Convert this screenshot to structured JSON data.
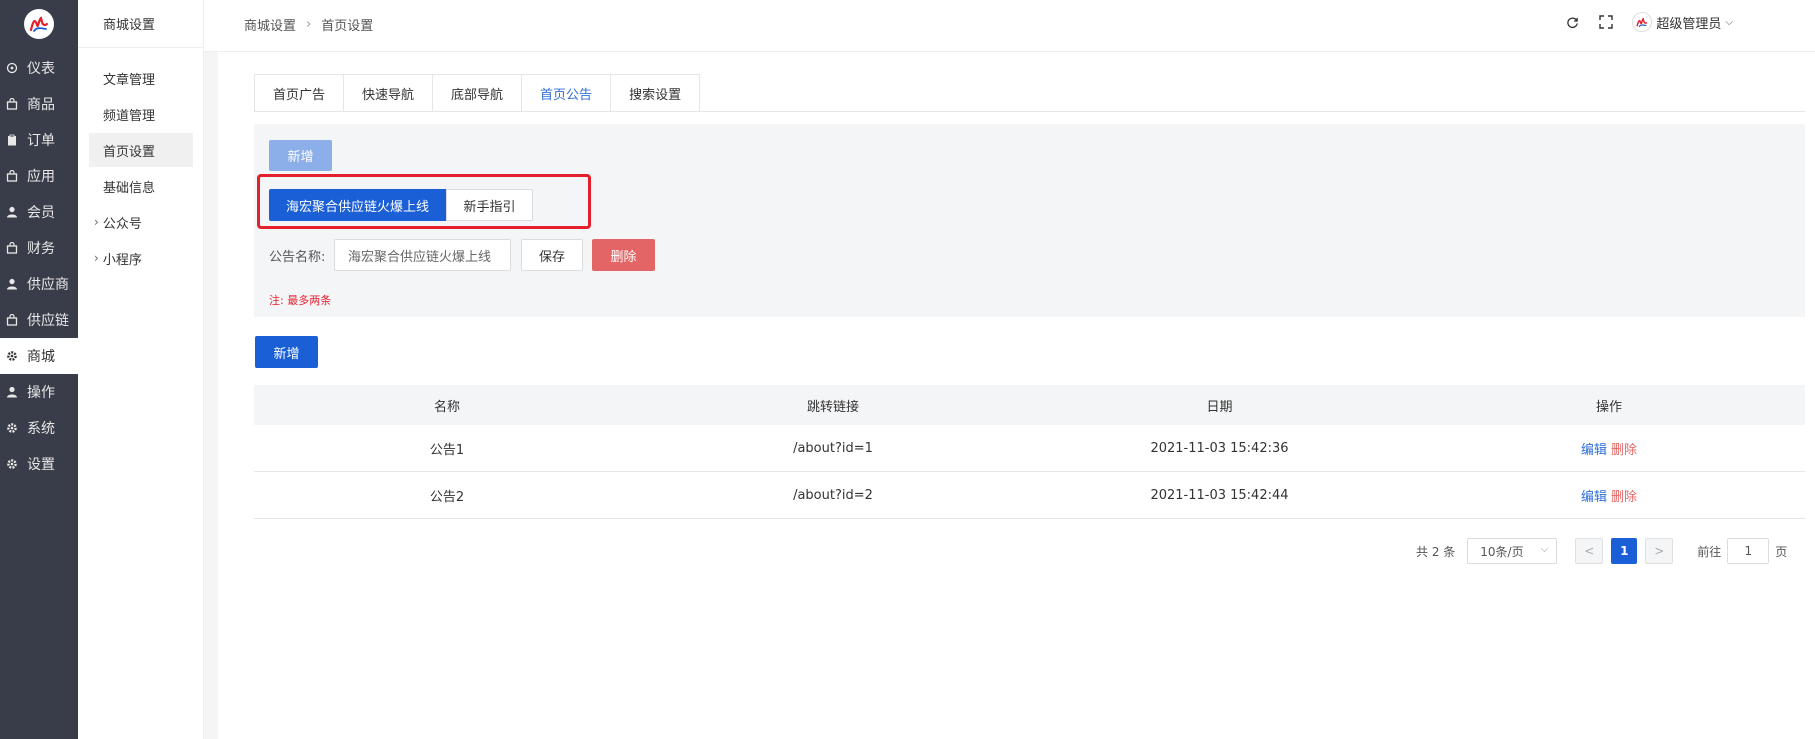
{
  "sidebar": {
    "items": [
      {
        "label": "仪表",
        "icon": "dashboard-icon"
      },
      {
        "label": "商品",
        "icon": "bag-icon"
      },
      {
        "label": "订单",
        "icon": "clipboard-icon"
      },
      {
        "label": "应用",
        "icon": "bag-icon"
      },
      {
        "label": "会员",
        "icon": "user-icon"
      },
      {
        "label": "财务",
        "icon": "bag-icon"
      },
      {
        "label": "供应商",
        "icon": "user-icon"
      },
      {
        "label": "供应链",
        "icon": "bag-icon"
      },
      {
        "label": "商城",
        "icon": "gear-icon"
      },
      {
        "label": "操作",
        "icon": "user-icon"
      },
      {
        "label": "系统",
        "icon": "gear-icon"
      },
      {
        "label": "设置",
        "icon": "gear-icon"
      }
    ],
    "active": "商城"
  },
  "subnav": {
    "title": "商城设置",
    "items": [
      {
        "label": "文章管理"
      },
      {
        "label": "频道管理"
      },
      {
        "label": "首页设置"
      },
      {
        "label": "基础信息"
      },
      {
        "label": "公众号",
        "expandable": true
      },
      {
        "label": "小程序",
        "expandable": true
      }
    ],
    "active": "首页设置"
  },
  "header": {
    "breadcrumb": [
      "商城设置",
      "首页设置"
    ],
    "user": "超级管理员"
  },
  "tabs": [
    "首页广告",
    "快速导航",
    "底部导航",
    "首页公告",
    "搜索设置"
  ],
  "active_tab": "首页公告",
  "panel": {
    "add_label": "新增",
    "notice_tabs": [
      "海宏聚合供应链火爆上线",
      "新手指引"
    ],
    "field_label": "公告名称:",
    "field_value": "海宏聚合供应链火爆上线",
    "save_label": "保存",
    "delete_label": "删除",
    "note": "注: 最多两条"
  },
  "list": {
    "add_label": "新增",
    "columns": [
      "名称",
      "跳转链接",
      "日期",
      "操作"
    ],
    "rows": [
      {
        "name": "公告1",
        "link": "/about?id=1",
        "date": "2021-11-03 15:42:36",
        "edit": "编辑",
        "delete": "删除"
      },
      {
        "name": "公告2",
        "link": "/about?id=2",
        "date": "2021-11-03 15:42:44",
        "edit": "编辑",
        "delete": "删除"
      }
    ]
  },
  "pagination": {
    "total": "共 2 条",
    "page_size": "10条/页",
    "prev": "<",
    "current": "1",
    "next": ">",
    "goto_prefix": "前往",
    "goto_value": "1",
    "goto_suffix": "页"
  },
  "colors": {
    "sidebar_bg": "#393d49",
    "primary": "#1a5fd6",
    "primary_light": "#8cafea",
    "danger": "#e36565",
    "highlight_border": "#e5202d"
  }
}
